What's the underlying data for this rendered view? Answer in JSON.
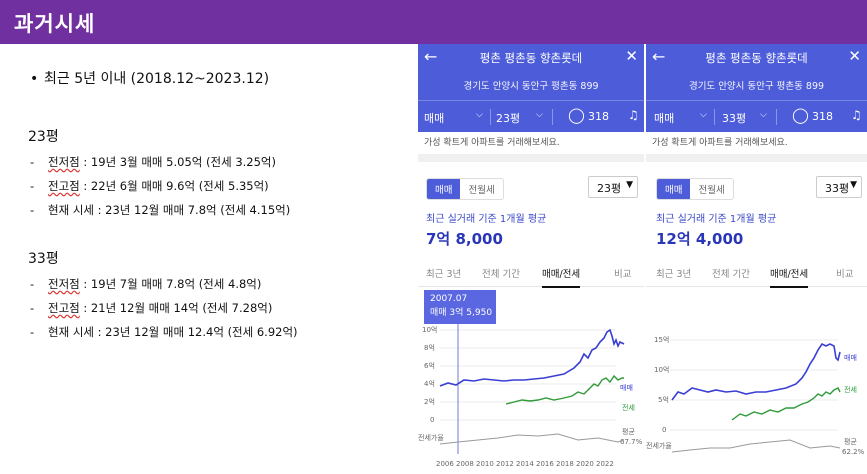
{
  "header": {
    "title": "과거시세"
  },
  "left": {
    "bullet": "최근 5년 이내 (2018.12~2023.12)",
    "groups": [
      {
        "title": "23평",
        "items": [
          {
            "label": "전저점",
            "rest": " : 19년 3월 매매 5.05억 (전세 3.25억)"
          },
          {
            "label": "전고점",
            "rest": " : 22년 6월 매매 9.6억 (전세 5.35억)"
          },
          {
            "label": "현재 시세",
            "rest": " : 23년 12월 매매 7.8억 (전세 4.15억)"
          }
        ]
      },
      {
        "title": "33평",
        "items": [
          {
            "label": "전저점",
            "rest": " : 19년 7월 매매 7.8억 (전세 4.8억)"
          },
          {
            "label": "전고점",
            "rest": " : 21년 12월 매매 14억 (전세 7.28억)"
          },
          {
            "label": "현재 시세",
            "rest": " : 23년 12월 매매 12.4억 (전세 6.92억)"
          }
        ]
      }
    ]
  },
  "phones": [
    {
      "name": "평촌 평촌동 향촌롯데",
      "address": "경기도 안양시 동안구 평촌동 899",
      "deal_type": "매매",
      "size": "23평",
      "comments": "318",
      "clipped_text": "가성 확트게 아파트를 거래해보세요.",
      "tab_trade": "매매",
      "tab_jeonse": "전월세",
      "size_select": "23평",
      "avg_label": "최근 실거래 기준 1개월 평균",
      "avg_value": "7억 8,000",
      "period_tabs": [
        "최근 3년",
        "전체 기간",
        "매매/전세",
        "비교"
      ],
      "tooltip_date": "2007.07",
      "tooltip_value": "매매 3억 5,950",
      "y_ticks": [
        "10억",
        "8억",
        "6억",
        "4억",
        "2억",
        "0"
      ],
      "x_ticks": [
        "2006",
        "2008",
        "2010",
        "2012",
        "2014",
        "2016",
        "2018",
        "2020",
        "2022"
      ],
      "series_trade_label": "매매",
      "series_jeonse_label": "전세",
      "ratio_label": "전세가율",
      "ratio_value_label": "평균",
      "ratio_value": "67.7%",
      "colors": {
        "trade": "#3a3fd4",
        "jeonse": "#2f9a3a",
        "ratio": "#999999"
      }
    },
    {
      "name": "평촌 평촌동 향촌롯데",
      "address": "경기도 안양시 동안구 평촌동 899",
      "deal_type": "매매",
      "size": "33평",
      "comments": "318",
      "clipped_text": "가성 확트게 아파트를 거래해보세요.",
      "tab_trade": "매매",
      "tab_jeonse": "전월세",
      "size_select": "33평",
      "avg_label": "최근 실거래 기준 1개월 평균",
      "avg_value": "12억 4,000",
      "period_tabs": [
        "최근 3년",
        "전체 기간",
        "매매/전세",
        "비교"
      ],
      "y_ticks": [
        "15억",
        "10억",
        "5억",
        "0"
      ],
      "series_trade_label": "매매",
      "series_jeonse_label": "전세",
      "ratio_label": "전세가율",
      "ratio_value_label": "평균",
      "ratio_value": "62.2%",
      "colors": {
        "trade": "#3a3fd4",
        "jeonse": "#2f9a3a",
        "ratio": "#999999"
      }
    }
  ]
}
